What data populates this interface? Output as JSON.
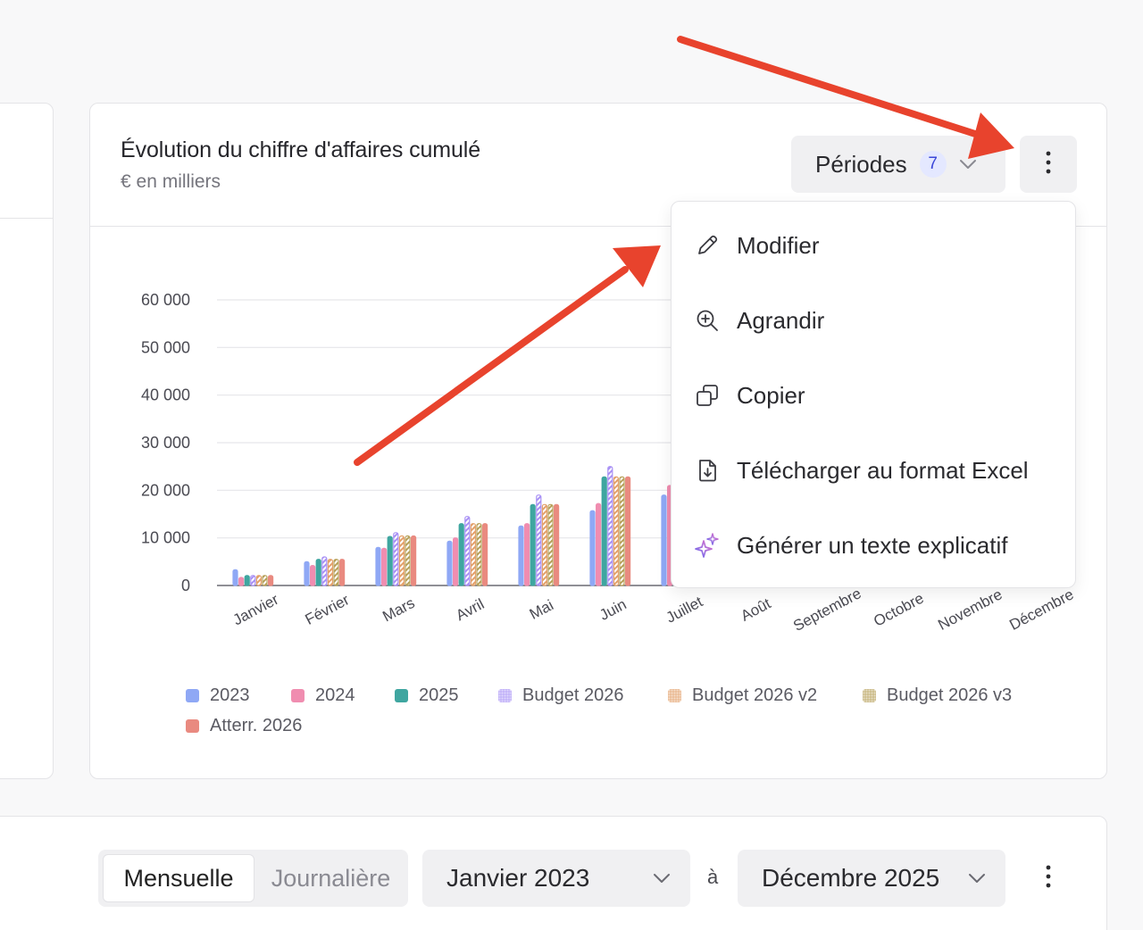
{
  "card": {
    "title": "Évolution du chiffre d'affaires cumulé",
    "subtitle": "€ en milliers"
  },
  "periods": {
    "label": "Périodes",
    "count": "7"
  },
  "menu": {
    "items": [
      {
        "label": "Modifier",
        "icon": "pencil-icon"
      },
      {
        "label": "Agrandir",
        "icon": "zoom-in-icon"
      },
      {
        "label": "Copier",
        "icon": "copy-icon"
      },
      {
        "label": "Télécharger au format Excel",
        "icon": "file-download-icon"
      },
      {
        "label": "Générer un texte explicatif",
        "icon": "sparkles-icon"
      }
    ]
  },
  "bottom": {
    "granularity_active": "Mensuelle",
    "granularity_inactive": "Journalière",
    "from": "Janvier 2023",
    "separator": "à",
    "to": "Décembre 2025"
  },
  "chart_data": {
    "type": "bar",
    "categories": [
      "Janvier",
      "Février",
      "Mars",
      "Avril",
      "Mai",
      "Juin",
      "Juillet",
      "Août",
      "Septembre",
      "Octobre",
      "Novembre",
      "Décembre"
    ],
    "yticks": [
      "60 000",
      "50 000",
      "40 000",
      "30 000",
      "20 000",
      "10 000",
      "0"
    ],
    "ylim": [
      0,
      60000
    ],
    "grid": true,
    "legend_position": "bottom",
    "series": [
      {
        "name": "2023",
        "color": "#8fa8f5",
        "pattern": "solid",
        "values": [
          3300,
          5000,
          8000,
          9300,
          12500,
          15700,
          19000,
          null,
          null,
          null,
          null,
          null
        ]
      },
      {
        "name": "2024",
        "color": "#f08db0",
        "pattern": "solid",
        "values": [
          1700,
          4200,
          7800,
          10000,
          13000,
          17200,
          21000,
          null,
          null,
          null,
          null,
          null
        ]
      },
      {
        "name": "2025",
        "color": "#3fa6a0",
        "pattern": "solid",
        "values": [
          2100,
          5500,
          10300,
          13000,
          17000,
          22800,
          null,
          null,
          null,
          null,
          null,
          null
        ]
      },
      {
        "name": "Budget 2026",
        "color": "#a890f5",
        "pattern": "dotted",
        "values": [
          2100,
          6000,
          11100,
          14500,
          19000,
          25000,
          null,
          null,
          null,
          null,
          null,
          null
        ]
      },
      {
        "name": "Budget 2026 v2",
        "color": "#e3a06a",
        "pattern": "dotted",
        "values": [
          2100,
          5500,
          10400,
          13000,
          17000,
          22800,
          null,
          null,
          null,
          null,
          null,
          null
        ]
      },
      {
        "name": "Budget 2026 v3",
        "color": "#b7a15a",
        "pattern": "dotted",
        "values": [
          2100,
          5500,
          10400,
          13000,
          17000,
          22800,
          null,
          null,
          null,
          null,
          null,
          null
        ]
      },
      {
        "name": "Atterr. 2026",
        "color": "#e98a80",
        "pattern": "solid",
        "values": [
          2100,
          5500,
          10400,
          13000,
          17000,
          22800,
          null,
          null,
          null,
          null,
          null,
          null
        ]
      }
    ]
  }
}
